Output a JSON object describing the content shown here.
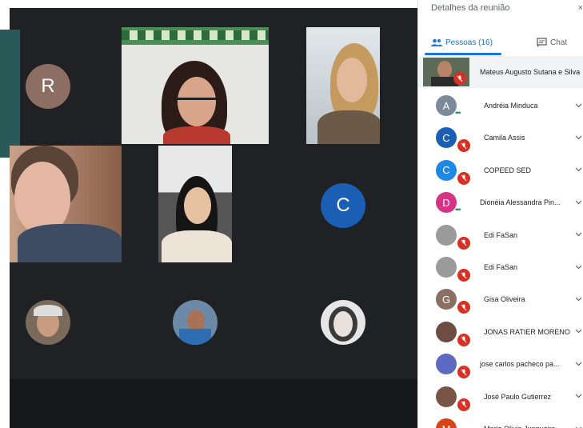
{
  "panel": {
    "title": "Detalhes da reunião",
    "close_label": "×",
    "tabs": {
      "people": "Pessoas (16)",
      "chat": "Chat"
    },
    "first_participant": "Mateus Augusto Sutana e Silva",
    "participants": [
      {
        "name": "Andréia Minduca",
        "initial": "A",
        "color": "#7b8a99",
        "muted": false
      },
      {
        "name": "Camila Assis",
        "initial": "C",
        "color": "#1a5fb4",
        "muted": true
      },
      {
        "name": "COPEED SED",
        "initial": "C",
        "color": "#1e88e5",
        "muted": true
      },
      {
        "name": "Dionéia Alessandra Pin...",
        "initial": "D",
        "color": "#d63384",
        "muted": false
      },
      {
        "name": "Edi FaSan",
        "initial": "",
        "color": "#9a9a9a",
        "muted": true
      },
      {
        "name": "Edi FaSan",
        "initial": "",
        "color": "#9a9a9a",
        "muted": true
      },
      {
        "name": "Gisa Oliveira",
        "initial": "G",
        "color": "#8d6e63",
        "muted": true
      },
      {
        "name": "JONAS RATIER MORENO",
        "initial": "",
        "color": "#6d4c41",
        "muted": true
      },
      {
        "name": "jose carlos pacheco pa...",
        "initial": "",
        "color": "#5c6bc0",
        "muted": true
      },
      {
        "name": "José Paulo Gutierrez",
        "initial": "",
        "color": "#795548",
        "muted": true
      },
      {
        "name": "Maria Olivia Junqueira",
        "initial": "M",
        "color": "#d84315",
        "muted": true
      }
    ]
  },
  "grid": {
    "avatar_r": "R",
    "avatar_c": "C"
  },
  "colors": {
    "accent": "#1a73e8",
    "muted_red": "#d93025",
    "grid_bg": "#202124"
  }
}
